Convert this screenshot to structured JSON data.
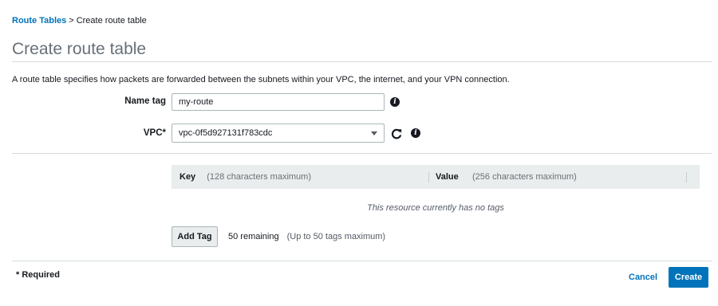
{
  "breadcrumb": {
    "parent": "Route Tables",
    "separator": ">",
    "current": "Create route table"
  },
  "page": {
    "title": "Create route table",
    "description": "A route table specifies how packets are forwarded between the subnets within your VPC, the internet, and your VPN connection."
  },
  "form": {
    "name_tag": {
      "label": "Name tag",
      "value": "my-route"
    },
    "vpc": {
      "label": "VPC*",
      "value": "vpc-0f5d927131f783cdc"
    }
  },
  "tags": {
    "key_header": "Key",
    "key_hint": "(128 characters maximum)",
    "value_header": "Value",
    "value_hint": "(256 characters maximum)",
    "empty_message": "This resource currently has no tags",
    "add_button": "Add Tag",
    "remaining": "50 remaining",
    "remaining_hint": "(Up to 50 tags maximum)"
  },
  "footer": {
    "required_note": "* Required",
    "cancel_label": "Cancel",
    "create_label": "Create"
  },
  "icons": {
    "info": "info-icon",
    "refresh": "refresh-icon",
    "dropdown": "chevron-down-icon"
  },
  "colors": {
    "link": "#0073bb",
    "primary_button": "#0073bb",
    "header_bg": "#eaeded"
  }
}
